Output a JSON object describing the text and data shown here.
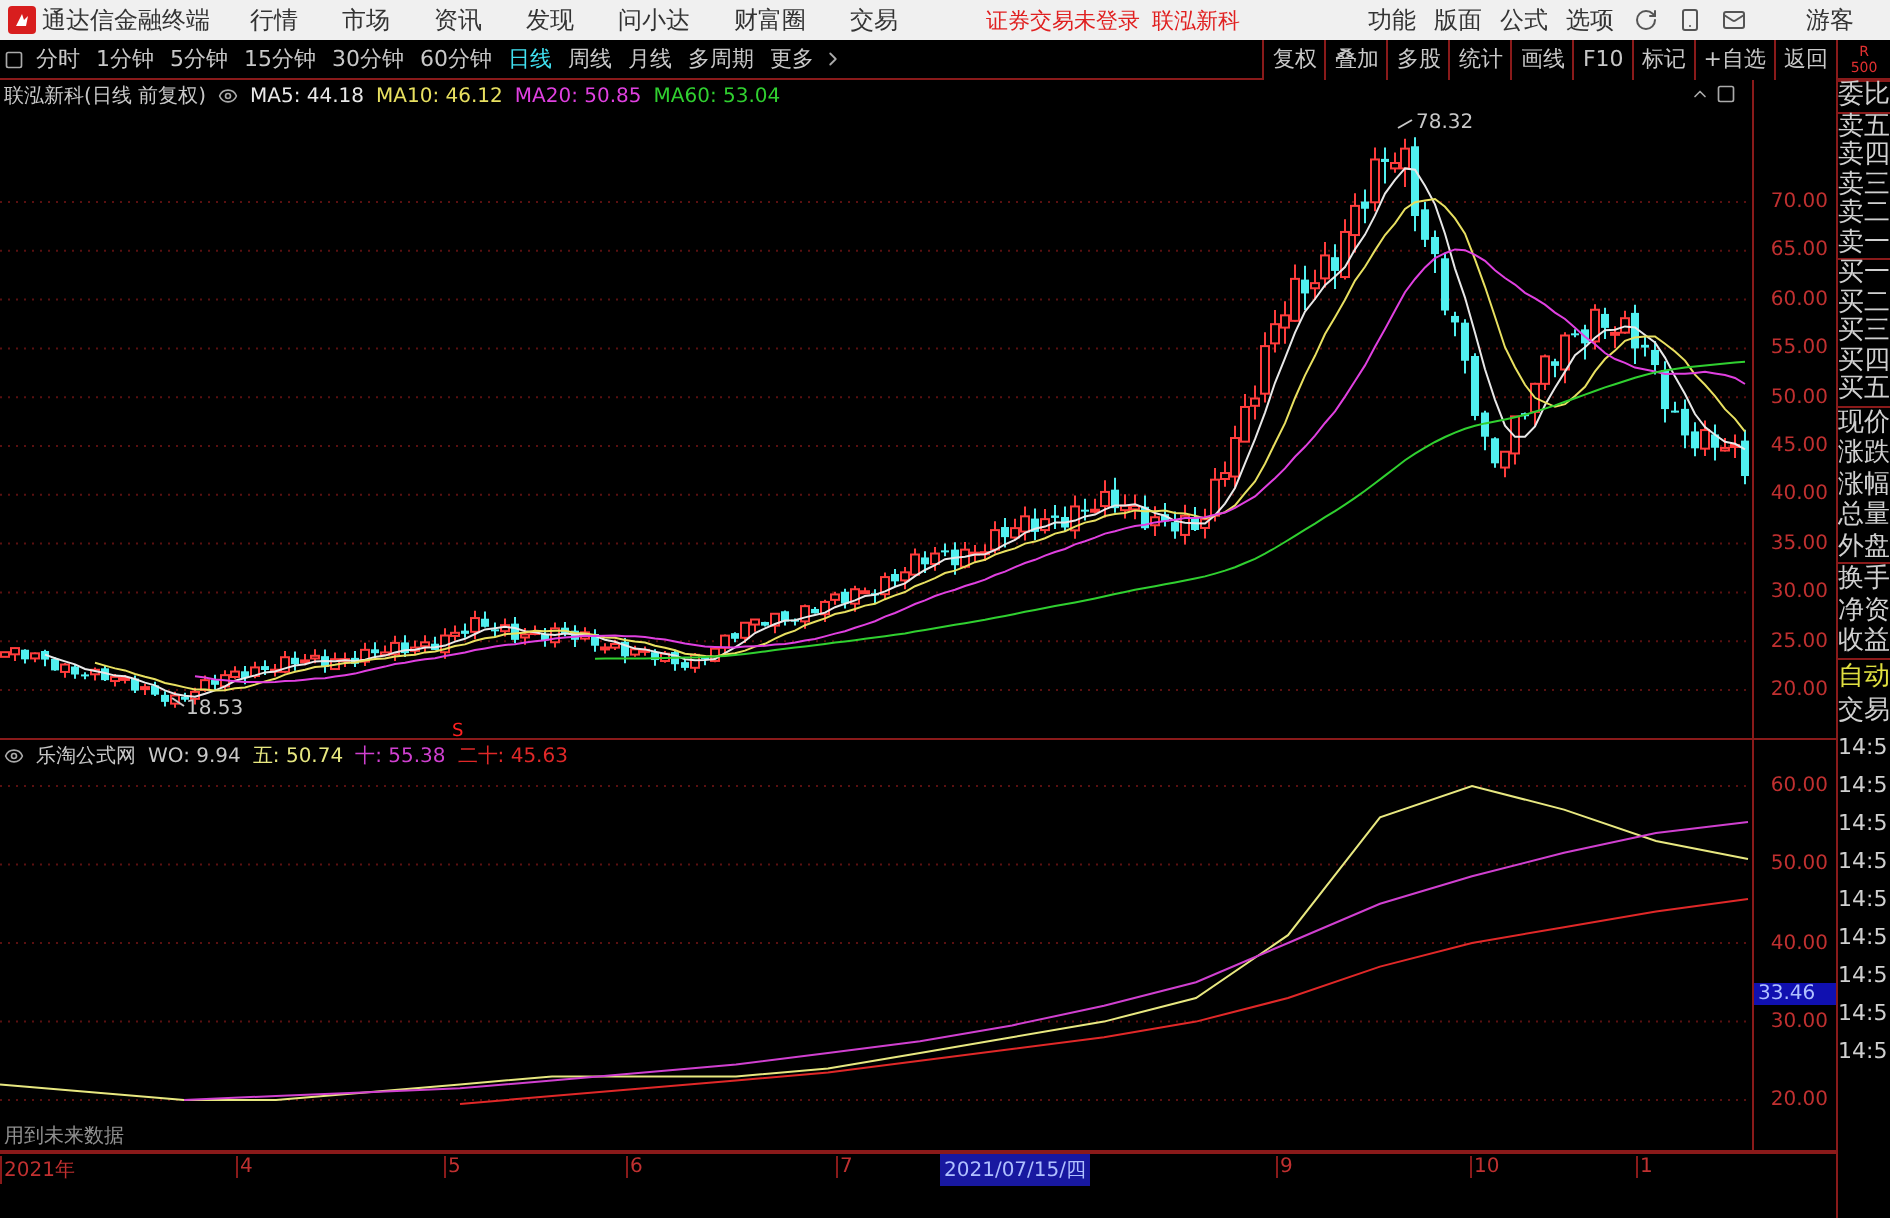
{
  "top_bar": {
    "app_title": "通达信金融终端",
    "menu": [
      "行情",
      "市场",
      "资讯",
      "发现",
      "问小达",
      "财富圈",
      "交易"
    ],
    "notice": "证券交易未登录",
    "stock_link": "联泓新科",
    "right_menu": [
      "功能",
      "版面",
      "公式",
      "选项"
    ],
    "user": "游客"
  },
  "toolbar": {
    "periods": [
      {
        "label": "分时",
        "selected": false
      },
      {
        "label": "1分钟",
        "selected": false
      },
      {
        "label": "5分钟",
        "selected": false
      },
      {
        "label": "15分钟",
        "selected": false
      },
      {
        "label": "30分钟",
        "selected": false
      },
      {
        "label": "60分钟",
        "selected": false
      },
      {
        "label": "日线",
        "selected": true
      },
      {
        "label": "周线",
        "selected": false
      },
      {
        "label": "月线",
        "selected": false
      },
      {
        "label": "多周期",
        "selected": false
      },
      {
        "label": "更多",
        "selected": false
      }
    ],
    "buttons": [
      "复权",
      "叠加",
      "多股",
      "统计",
      "画线",
      "F10",
      "标记",
      "+自选",
      "返回"
    ],
    "badge": [
      "R",
      "500"
    ]
  },
  "price_chart": {
    "title": "联泓新科(日线 前复权)",
    "ma": [
      {
        "label": "MA5: 44.18",
        "color": "#e8e8e8"
      },
      {
        "label": "MA10: 46.12",
        "color": "#e8e060"
      },
      {
        "label": "MA20: 50.85",
        "color": "#e040e0"
      },
      {
        "label": "MA60: 53.04",
        "color": "#30d030"
      }
    ],
    "high_label": "78.32",
    "low_label": "18.53",
    "signal": "S",
    "yticks": [
      "70.00",
      "65.00",
      "60.00",
      "55.00",
      "50.00",
      "45.00",
      "40.00",
      "35.00",
      "30.00",
      "25.00",
      "20.00"
    ]
  },
  "indicator": {
    "title": "乐淘公式网",
    "values": [
      {
        "label": "WO: 9.94",
        "color": "#c8c8c8"
      },
      {
        "label": "五: 50.74",
        "color": "#e8e880"
      },
      {
        "label": "十: 55.38",
        "color": "#d040d0"
      },
      {
        "label": "二十: 45.63",
        "color": "#e02828"
      }
    ],
    "cursor_value": "33.46",
    "note": "用到未来数据",
    "chart_data": {
      "type": "line",
      "grid": true,
      "ylim": [
        13.38,
        61.78
      ],
      "yticks": [
        {
          "value": 60,
          "label": "60.00"
        },
        {
          "value": 50,
          "label": "50.00"
        },
        {
          "value": 40,
          "label": "40.00"
        },
        {
          "value": 30,
          "label": "30.00"
        },
        {
          "value": 20,
          "label": "20.00"
        }
      ],
      "series": [
        {
          "color": "#e8e880",
          "values": [
            22,
            21,
            20,
            20,
            21,
            22,
            23,
            23,
            23,
            24,
            26,
            28,
            30,
            33,
            41,
            56,
            60,
            57,
            53,
            50.7
          ]
        },
        {
          "color": "#d040d0",
          "values": [
            null,
            null,
            20,
            20.5,
            21,
            21.5,
            22.5,
            23.5,
            24.5,
            26,
            27.5,
            29.5,
            32,
            35,
            40,
            45,
            48.5,
            51.5,
            54,
            55.4
          ]
        },
        {
          "color": "#e02828",
          "values": [
            null,
            null,
            null,
            null,
            null,
            19.5,
            20.5,
            21.5,
            22.5,
            23.5,
            25,
            26.5,
            28,
            30,
            33,
            37,
            40,
            42,
            44,
            45.6
          ]
        }
      ]
    }
  },
  "date_axis": {
    "labels": [
      "2021年",
      "4",
      "5",
      "6",
      "7",
      "9",
      "10",
      "1"
    ],
    "cursor": "2021/07/15/四"
  },
  "side_panel": {
    "quote_labels": [
      "委比",
      "卖五",
      "卖四",
      "卖三",
      "卖二",
      "卖一",
      "买一",
      "买二",
      "买三",
      "买四",
      "买五",
      "现价",
      "涨跌",
      "涨幅",
      "总量",
      "外盘",
      "换手",
      "净资",
      "收益"
    ],
    "auto": "自动",
    "trade": "交易",
    "times": [
      "14:5",
      "14:5",
      "14:5",
      "14:5",
      "14:5",
      "14:5",
      "14:5",
      "14:5",
      "14:5"
    ]
  }
}
